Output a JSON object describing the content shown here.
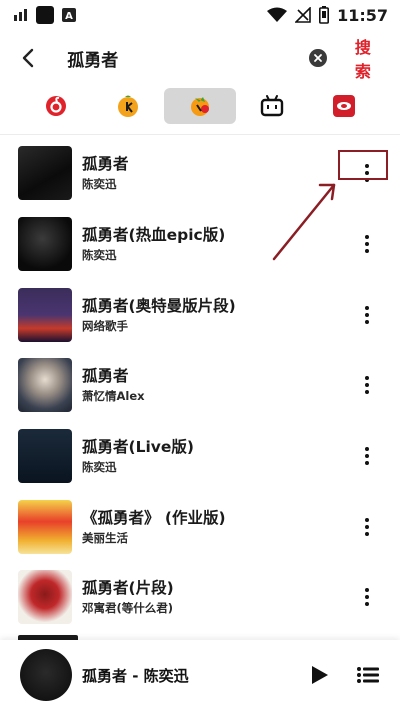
{
  "status_bar": {
    "time": "11:57",
    "icons": [
      "signal-bars-icon",
      "notification-square-icon",
      "font-a-icon",
      "wifi-icon",
      "no-signal-icon",
      "battery-icon"
    ]
  },
  "search": {
    "query": "孤勇者",
    "button_label": "搜索",
    "icons": [
      "back-arrow-icon",
      "clear-icon"
    ]
  },
  "sources": [
    {
      "name": "netease-music",
      "active": false
    },
    {
      "name": "kuwo-music",
      "active": false
    },
    {
      "name": "qq-music",
      "active": true
    },
    {
      "name": "bilibili",
      "active": false
    },
    {
      "name": "migu-music",
      "active": false
    }
  ],
  "songs": [
    {
      "title": "孤勇者",
      "artist": "陈奕迅"
    },
    {
      "title": "孤勇者(热血epic版)",
      "artist": "陈奕迅"
    },
    {
      "title": "孤勇者(奥特曼版片段)",
      "artist": "网络歌手"
    },
    {
      "title": "孤勇者",
      "artist": "萧忆情Alex"
    },
    {
      "title": "孤勇者(Live版)",
      "artist": "陈奕迅"
    },
    {
      "title": "《孤勇者》 (作业版)",
      "artist": "美丽生活"
    },
    {
      "title": "孤勇者(片段)",
      "artist": "邓寓君(等什么君)"
    }
  ],
  "player": {
    "now_playing": "孤勇者 - 陈奕迅"
  },
  "colors": {
    "accent": "#e0222b",
    "annotation": "#8b1e24",
    "active_tab_bg": "#d6d6d6"
  }
}
